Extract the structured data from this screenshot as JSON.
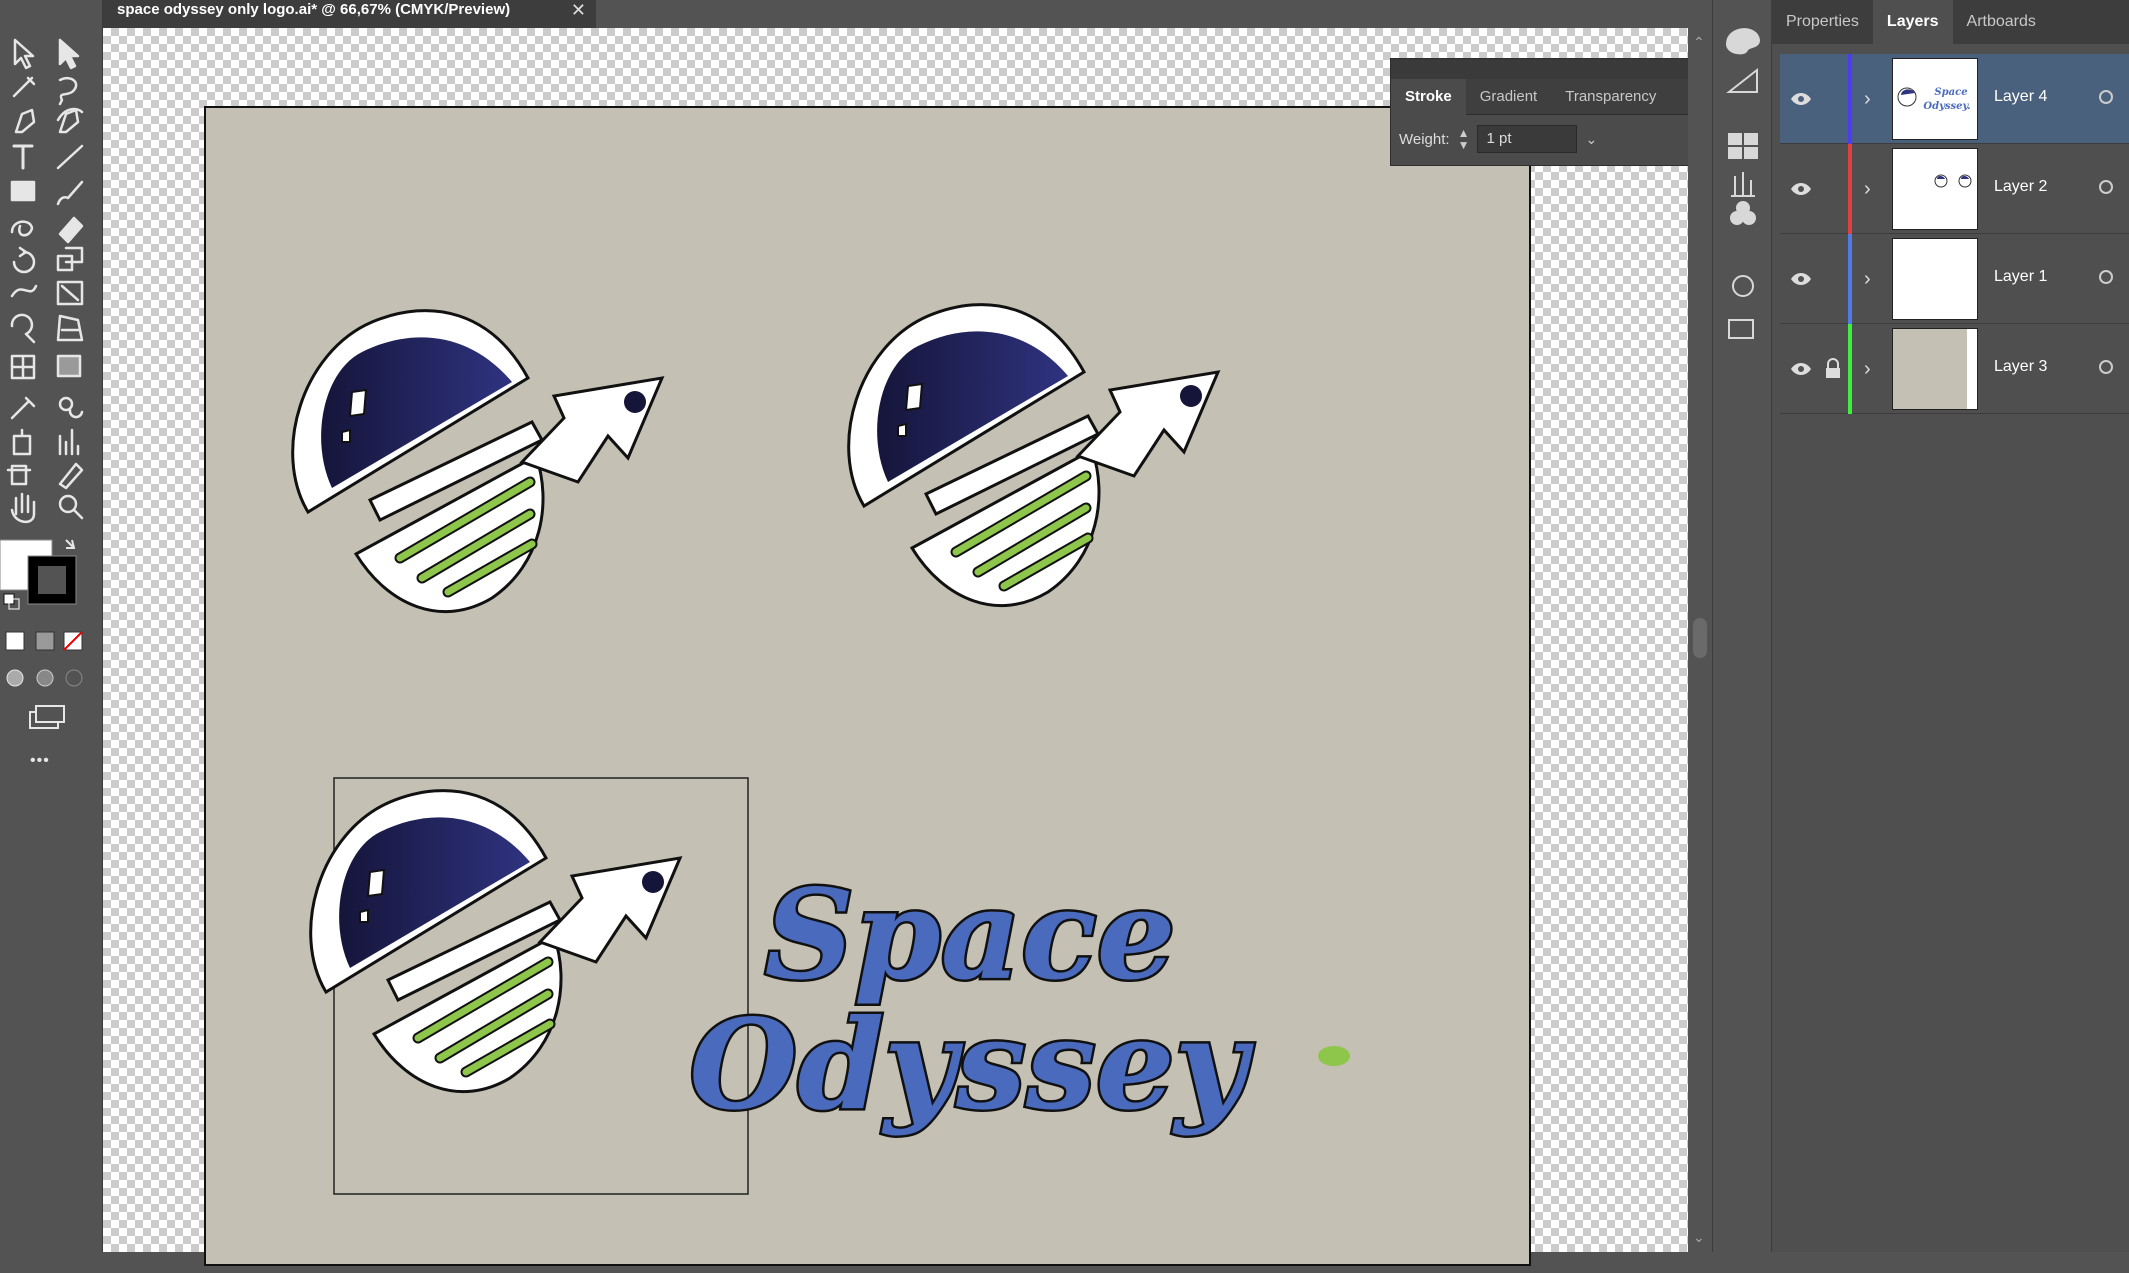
{
  "document": {
    "tab_title": "space odyssey only logo.ai* @ 66,67% (CMYK/Preview)",
    "close_glyph": "✕"
  },
  "stroke_panel": {
    "tabs": [
      {
        "label": "Stroke",
        "active": true
      },
      {
        "label": "Gradient",
        "active": false
      },
      {
        "label": "Transparency",
        "active": false
      }
    ],
    "weight_label": "Weight:",
    "weight_value": "1 pt"
  },
  "layers_panel": {
    "tabs": [
      {
        "label": "Properties",
        "active": false
      },
      {
        "label": "Layers",
        "active": true
      },
      {
        "label": "Artboards",
        "active": false
      }
    ],
    "layers": [
      {
        "name": "Layer 4",
        "color": "#4d3df0",
        "selected": true,
        "locked": false,
        "visible": true
      },
      {
        "name": "Layer 2",
        "color": "#e2403d",
        "selected": false,
        "locked": false,
        "visible": true
      },
      {
        "name": "Layer 1",
        "color": "#4f7be8",
        "selected": false,
        "locked": false,
        "visible": true
      },
      {
        "name": "Layer 3",
        "color": "#3ef03e",
        "selected": false,
        "locked": true,
        "visible": true
      }
    ]
  },
  "artwork": {
    "logo_line1": "Space",
    "logo_line2": "Odyssey",
    "thumb_text_1": "Space",
    "thumb_text_2": "Odyssey.",
    "colors": {
      "artboard": "#c4c0b3",
      "text_blue": "#4a6bbd",
      "green": "#8dc64a",
      "helmet_dark": "#1c1c44",
      "helmet_light": "#2f3380"
    }
  },
  "toolbar": {
    "tools": [
      "selection-tool-icon",
      "direct-selection-tool-icon",
      "magic-wand-icon",
      "lasso-icon",
      "pen-tool-icon",
      "curvature-tool-icon",
      "type-tool-icon",
      "line-segment-icon",
      "rectangle-tool-icon",
      "paintbrush-icon",
      "shaper-tool-icon",
      "eraser-icon",
      "rotate-tool-icon",
      "scale-tool-icon",
      "width-tool-icon",
      "free-transform-icon",
      "shape-builder-icon",
      "perspective-grid-icon",
      "mesh-tool-icon",
      "gradient-tool-icon",
      "eyedropper-icon",
      "blend-tool-icon",
      "symbol-sprayer-icon",
      "column-graph-icon",
      "artboard-tool-icon",
      "slice-tool-icon",
      "hand-tool-icon",
      "zoom-tool-icon"
    ],
    "more_label": "•••"
  }
}
